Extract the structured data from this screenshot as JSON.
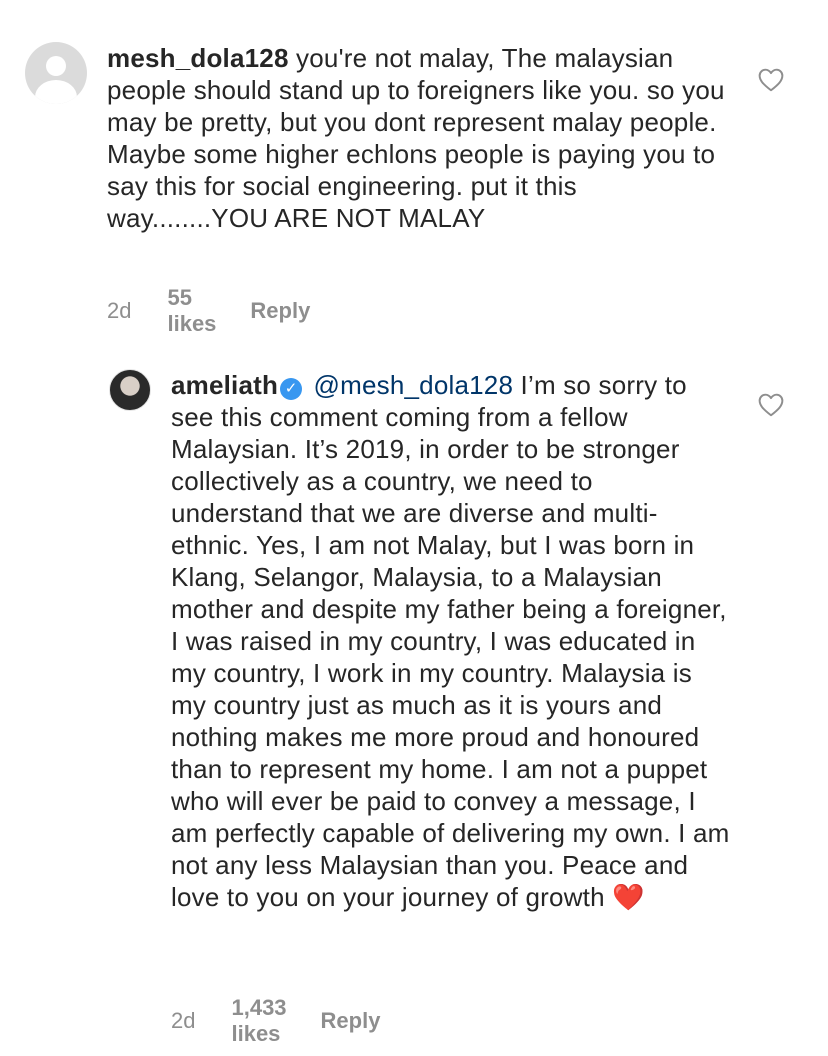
{
  "comments": [
    {
      "username": "mesh_dola128",
      "text": "you're not malay, The malaysian people should stand up to foreigners like you. so you may be pretty, but you dont represent malay people. Maybe some higher echlons people is paying you to say this for social engineering. put it this way........YOU ARE NOT MALAY",
      "time": "2d",
      "likes": "55 likes",
      "reply_label": "Reply",
      "avatar_icon": "default-avatar-icon",
      "like_icon": "heart-outline-icon"
    },
    {
      "username": "ameliath",
      "verified": true,
      "verified_icon": "verified-badge-icon",
      "mention": "@mesh_dola128",
      "text": "I’m so sorry to see this comment coming from a fellow Malaysian. It’s 2019, in order to be stronger collectively as a country, we need to understand that we are diverse and multi-ethnic. Yes, I am not Malay, but I was born in Klang, Selangor, Malaysia, to a Malaysian mother and despite my father being a foreigner, I was raised in my country, I was educated in my country, I work in my country. Malaysia is my country just as much as it is yours and nothing makes me more proud and honoured than to represent my home. I am not a puppet who will ever be paid to convey a message, I am perfectly capable of delivering my own. I am not any less Malaysian than you. Peace and love to you on your journey of growth",
      "emoji": "❤️",
      "time": "2d",
      "likes": "1,433 likes",
      "reply_label": "Reply",
      "avatar_icon": "profile-photo-avatar",
      "like_icon": "heart-outline-icon"
    }
  ],
  "colors": {
    "text": "#262626",
    "meta": "#8e8e8e",
    "mention": "#003569",
    "verified": "#3897f0"
  }
}
